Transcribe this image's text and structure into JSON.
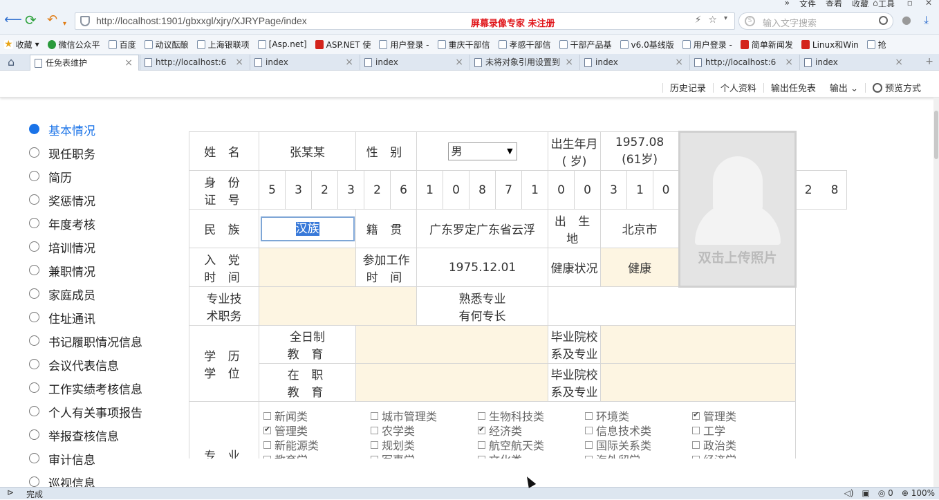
{
  "browser": {
    "menus": [
      "文件",
      "查看",
      "收藏",
      "工具"
    ],
    "url": "http://localhost:1901/gbxxgl/xjry/XJRYPage/index",
    "recorder_watermark": "屏幕录像专家  未注册",
    "search_placeholder": "输入文字搜索",
    "favorites": [
      "收藏",
      "微信公众平",
      "百度",
      "动议酝酿",
      "上海银联项",
      "[Asp.net]",
      "ASP.NET 使",
      "用户登录 -",
      "重庆干部信",
      "孝感干部信",
      "干部产品基",
      "v6.0基线版",
      "用户登录 -",
      "简单新闻发",
      "Linux和Win",
      "抢"
    ],
    "tabs": [
      "任免表维护",
      "http://localhost:6",
      "index",
      "index",
      "未将对象引用设置到",
      "index",
      "http://localhost:6",
      "index"
    ],
    "status_text": "完成",
    "status_count": "0",
    "zoom": "100%"
  },
  "actions": [
    "历史记录",
    "个人资料",
    "输出任免表",
    "输出",
    "预览方式"
  ],
  "sidebar": [
    {
      "label": "基本情况",
      "selected": true
    },
    {
      "label": "现任职务"
    },
    {
      "label": "简历"
    },
    {
      "label": "奖惩情况"
    },
    {
      "label": "年度考核"
    },
    {
      "label": "培训情况"
    },
    {
      "label": "兼职情况"
    },
    {
      "label": "家庭成员"
    },
    {
      "label": "住址通讯"
    },
    {
      "label": "书记履职情况信息"
    },
    {
      "label": "会议代表信息"
    },
    {
      "label": "工作实绩考核信息"
    },
    {
      "label": "个人有关事项报告"
    },
    {
      "label": "举报查核信息"
    },
    {
      "label": "审计信息"
    },
    {
      "label": "巡视信息"
    }
  ],
  "form": {
    "name_label": "姓 名",
    "name": "张某某",
    "gender_label": "性 别",
    "gender": "男",
    "birth_label_1": "出生年月",
    "birth_label_2": "( 岁)",
    "birth": "1957.08",
    "age": "(61岁)",
    "id_label_1": "身 份",
    "id_label_2": "证 号",
    "id_digits": [
      "5",
      "3",
      "2",
      "3",
      "2",
      "6",
      "1",
      "0",
      "8",
      "7",
      "1",
      "0",
      "0",
      "3",
      "1",
      "0",
      "2",
      "8"
    ],
    "photo_text": "双击上传照片",
    "ethnic_label": "民 族",
    "ethnic": "汉族",
    "native_label": "籍 贯",
    "native": "广东罗定广东省云浮",
    "birthplace_label": "出 生 地",
    "birthplace": "北京市",
    "party_label_1": "入 党",
    "party_label_2": "时 间",
    "party": "",
    "work_label_1": "参加工作",
    "work_label_2": "时 间",
    "work": "1975.12.01",
    "health_label": "健康状况",
    "health": "健康",
    "tech_label_1": "专业技",
    "tech_label_2": "术职务",
    "tech": "",
    "spec_label_1": "熟悉专业",
    "spec_label_2": "有何专长",
    "spec": "",
    "edu_label_1": "学 历",
    "edu_label_2": "学 位",
    "fulltime_1": "全日制",
    "fulltime_2": "教 育",
    "inservice_1": "在 职",
    "inservice_2": "教 育",
    "school_label_1": "毕业院校",
    "school_label_2": "系及专业",
    "major_label": "专 业",
    "categories": [
      {
        "label": "新闻类",
        "checked": false
      },
      {
        "label": "城市管理类",
        "checked": false
      },
      {
        "label": "生物科技类",
        "checked": false
      },
      {
        "label": "环境类",
        "checked": false
      },
      {
        "label": "管理类",
        "checked": true
      },
      {
        "label": "管理类",
        "checked": true
      },
      {
        "label": "农学类",
        "checked": false
      },
      {
        "label": "经济类",
        "checked": true
      },
      {
        "label": "信息技术类",
        "checked": false
      },
      {
        "label": "工学",
        "checked": false
      },
      {
        "label": "新能源类",
        "checked": false
      },
      {
        "label": "规划类",
        "checked": false
      },
      {
        "label": "航空航天类",
        "checked": false
      },
      {
        "label": "国际关系类",
        "checked": false
      },
      {
        "label": "政治类",
        "checked": false
      },
      {
        "label": "教育学",
        "checked": false
      },
      {
        "label": "军事学",
        "checked": false
      },
      {
        "label": "文化类",
        "checked": false
      },
      {
        "label": "海外留学",
        "checked": false
      },
      {
        "label": "经济学",
        "checked": false
      }
    ]
  }
}
